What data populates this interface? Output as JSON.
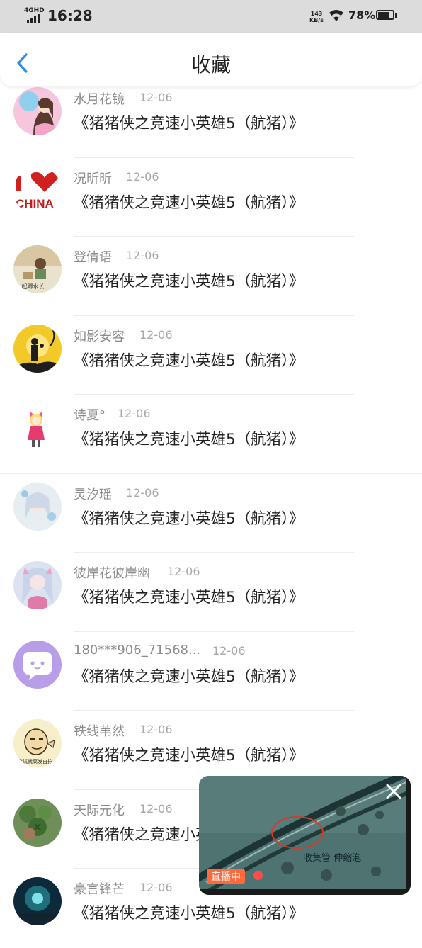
{
  "status_bar": {
    "network": "4GHD",
    "time": "16:28",
    "net_speed_value": "143",
    "net_speed_unit": "KB/s",
    "battery_percent": "78%",
    "battery_level": 0.78
  },
  "header": {
    "title": "收藏",
    "back_icon": "chevron-left-icon",
    "accent": "#2f8fe0"
  },
  "items": [
    {
      "name": "水月花镜",
      "date": "12-06",
      "content": "《猪猪侠之竞速小英雄5（航猪）》"
    },
    {
      "name": "况昕昕",
      "date": "12-06",
      "content": "《猪猪侠之竞速小英雄5（航猪）》"
    },
    {
      "name": "登倩语",
      "date": "12-06",
      "content": "《猪猪侠之竞速小英雄5（航猪）》"
    },
    {
      "name": "如影安容",
      "date": "12-06",
      "content": "《猪猪侠之竞速小英雄5（航猪）》"
    },
    {
      "name": "诗夏°",
      "date": "12-06",
      "content": "《猪猪侠之竞速小英雄5（航猪）》"
    },
    {
      "name": "灵汐瑶",
      "date": "12-06",
      "content": "《猪猪侠之竞速小英雄5（航猪）》"
    },
    {
      "name": "彼岸花彼岸幽",
      "date": "12-06",
      "content": "《猪猪侠之竞速小英雄5（航猪）》"
    },
    {
      "name": "180***906_71568...",
      "date": "12-06",
      "content": "《猪猪侠之竞速小英雄5（航猪）》"
    },
    {
      "name": "铁线苇然",
      "date": "12-06",
      "content": "《猪猪侠之竞速小英雄5（航猪）》"
    },
    {
      "name": "天际元化",
      "date": "12-06",
      "content": "《猪猪侠之竞速小英雄5（航猪）》"
    },
    {
      "name": "豪言锋芒",
      "date": "12-06",
      "content": "《猪猪侠之竞速小英雄5（航猪）》"
    }
  ],
  "mini_player": {
    "live_label": "直播中",
    "caption": "收集管 伸缩泡",
    "close_icon": "close-icon"
  }
}
